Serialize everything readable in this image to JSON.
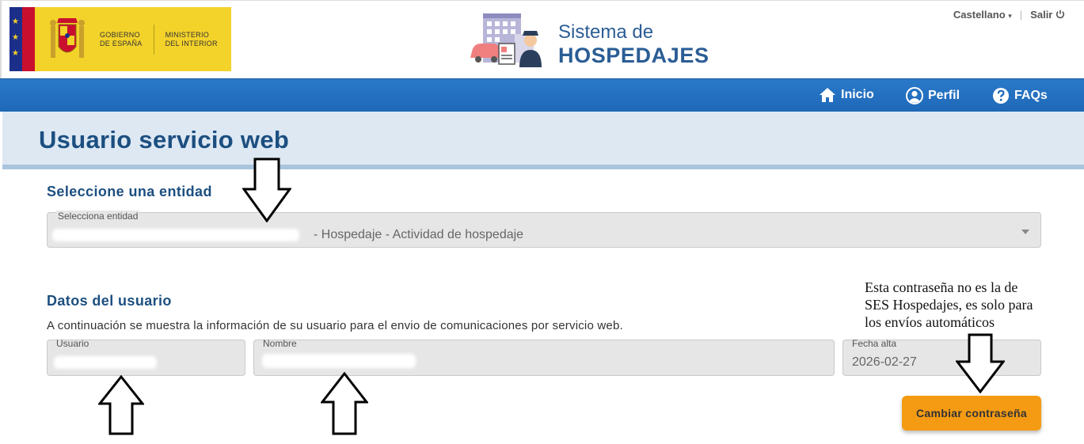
{
  "header": {
    "gov_line1": "GOBIERNO",
    "gov_line2": "DE ESPAÑA",
    "ministry_line1": "MINISTERIO",
    "ministry_line2": "DEL INTERIOR",
    "app_title_1": "Sistema de",
    "app_title_2": "HOSPEDAJES",
    "language": "Castellano",
    "logout": "Salir",
    "icons": [
      "chevron-down-icon",
      "power-icon"
    ]
  },
  "nav": {
    "items": [
      {
        "label": "Inicio",
        "icon": "home-icon"
      },
      {
        "label": "Perfil",
        "icon": "user-icon"
      },
      {
        "label": "FAQs",
        "icon": "question-icon"
      }
    ]
  },
  "page": {
    "title": "Usuario servicio web"
  },
  "entity": {
    "heading": "Seleccione una entidad",
    "select_label": "Selecciona entidad",
    "select_value_suffix": "- Hospedaje - Actividad de hospedaje"
  },
  "user": {
    "heading": "Datos del usuario",
    "info": "A continuación se muestra la información de su usuario para el envio de comunicaciones por servicio web.",
    "usuario_label": "Usuario",
    "nombre_label": "Nombre",
    "fecha_label": "Fecha alta",
    "fecha_value": "2026-02-27",
    "change_password_button": "Cambiar contraseña"
  },
  "annotation": {
    "note_line1": "Esta contraseña no es la de",
    "note_line2": "SES Hospedajes, es solo para",
    "note_line3": "los envíos automáticos"
  },
  "colors": {
    "nav_blue": "#2a79c9",
    "title_blue": "#1c4f80",
    "orange": "#f49b13",
    "gov_yellow": "#f3d22a"
  }
}
